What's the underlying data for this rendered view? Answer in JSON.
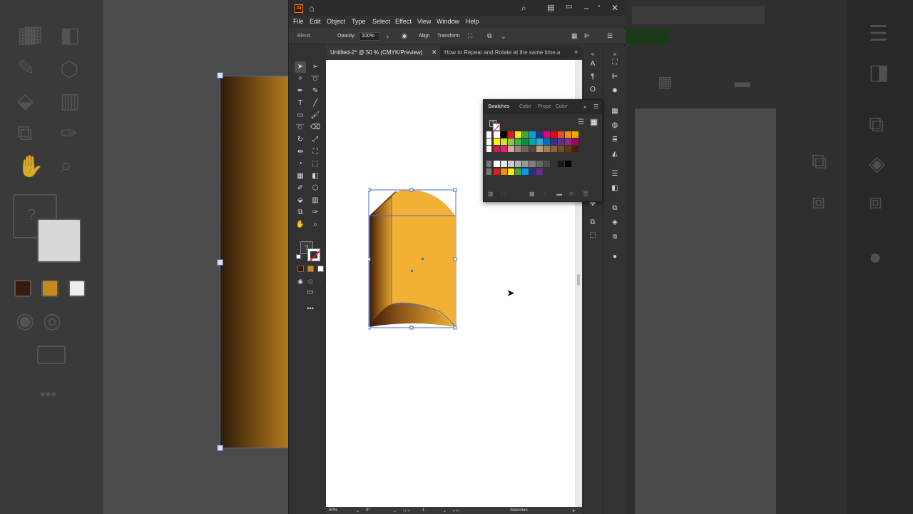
{
  "window": {
    "logo": "Ai",
    "app_menu": [
      "File",
      "Edit",
      "Object",
      "Type",
      "Select",
      "Effect",
      "View",
      "Window",
      "Help"
    ]
  },
  "control_bar": {
    "selection_type": "Blend",
    "opacity_label": "Opacity:",
    "opacity_value": "100%",
    "align_label": "Align",
    "transform_label": "Transform"
  },
  "tabs": [
    {
      "label": "Untitled-2* @ 50 % (CMYK/Preview)",
      "active": true
    },
    {
      "label": "How to Repeat and Rotate at the same time.a",
      "active": false
    }
  ],
  "swatches_panel": {
    "tabs": [
      "Swatches",
      "Color",
      "Prope",
      "Color"
    ],
    "rows": [
      [
        "#ffffff",
        "#000000",
        "#e4181c",
        "#fcec00",
        "#41a63c",
        "#00a1e4",
        "#2b3189",
        "#e5007e",
        "#e5001e",
        "#e94e1b",
        "#f29100",
        "#f7a600"
      ],
      [
        "#fff100",
        "#d7df21",
        "#8dc63f",
        "#39b54a",
        "#009245",
        "#00a99d",
        "#29abe2",
        "#0071bc",
        "#2e3192",
        "#662d91",
        "#93278f",
        "#9e005d"
      ],
      [
        "#d4145a",
        "#ed1e79",
        "#c7b299",
        "#998675",
        "#736357",
        "#534741",
        "#c69c6d",
        "#a67c52",
        "#8c6239",
        "#754c24",
        "#603813",
        "#42210b"
      ],
      [
        "#ffffff",
        "#e6e6e6",
        "#cccccc",
        "#b3b3b3",
        "#999999",
        "#808080",
        "#666666",
        "#4d4d4d",
        "#333333",
        "#1a1a1a",
        "#000000"
      ],
      [
        "#e4181c",
        "#f29100",
        "#fcec00",
        "#41a63c",
        "#00a1e4",
        "#2b3189",
        "#662d91"
      ]
    ]
  },
  "status_bar": {
    "zoom": "50%",
    "rotation": "0°",
    "artboard": "1",
    "mode": "Selection"
  },
  "colors": {
    "art_fill": "#f2b134",
    "art_shadow": "#3a1a08",
    "selection": "#4a6cc7"
  }
}
